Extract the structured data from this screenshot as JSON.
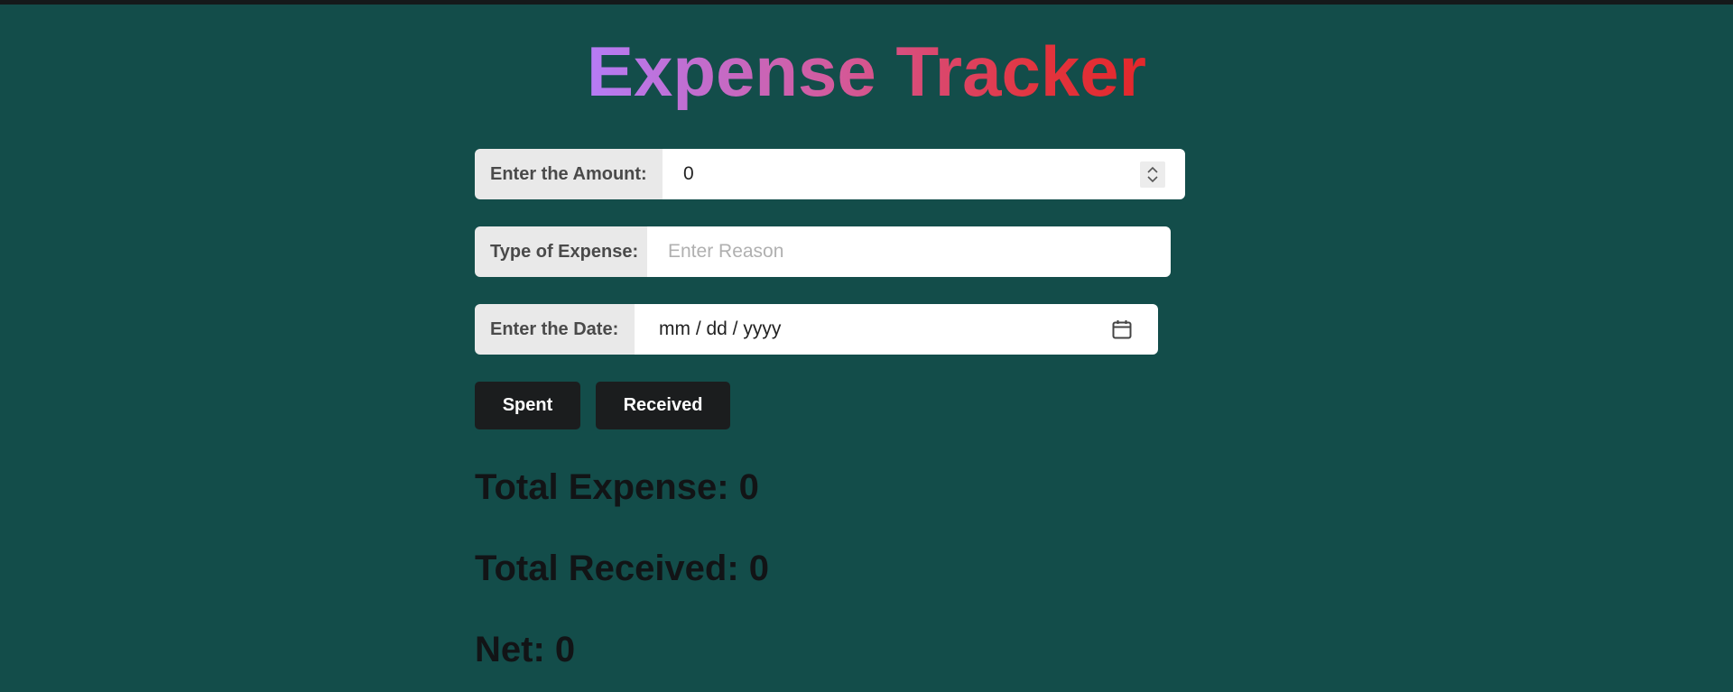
{
  "app": {
    "title": "Expense Tracker"
  },
  "form": {
    "amount": {
      "label": "Enter the Amount:",
      "value": "0"
    },
    "expense_type": {
      "label": "Type of Expense:",
      "placeholder": "Enter Reason"
    },
    "date": {
      "label": "Enter the Date:",
      "placeholder_text": "mm / dd / yyyy"
    }
  },
  "buttons": {
    "spent_label": "Spent",
    "received_label": "Received"
  },
  "totals": {
    "expense_text": "Total Expense: 0",
    "received_text": "Total Received: 0",
    "net_text": "Net: 0"
  },
  "icons": {
    "spinner": "number-spinner-icon",
    "calendar": "calendar-icon"
  },
  "colors": {
    "background": "#134d4a",
    "title_gradient_start": "#b57cf6",
    "title_gradient_end": "#e3272b",
    "button_bg": "#1b1d1e",
    "label_bg": "#e9e9e9"
  }
}
